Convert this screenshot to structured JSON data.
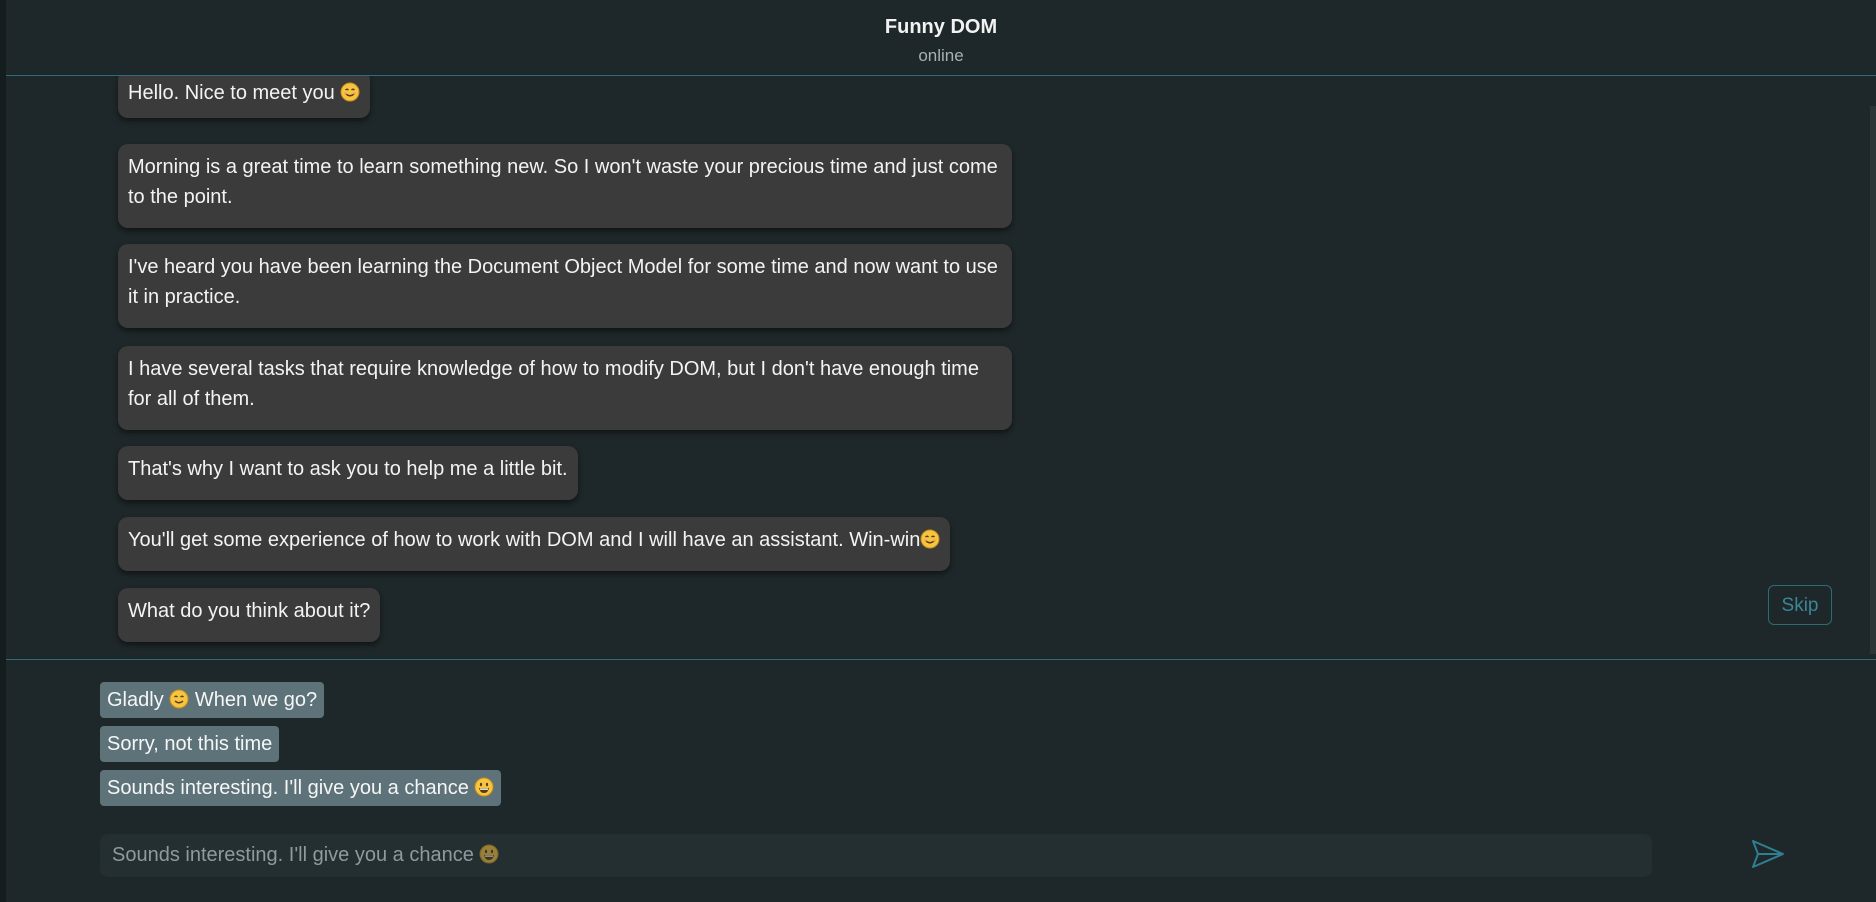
{
  "header": {
    "title": "Funny DOM",
    "status": "online"
  },
  "messages": [
    {
      "text": "Hello. Nice to meet you",
      "emoji": "smiling-face"
    },
    {
      "text": "Morning is a great time to learn something new. So I won't waste your precious time and just come to the point."
    },
    {
      "text": "I've heard you have been learning the Document Object Model for some time and now want to use it in practice."
    },
    {
      "text": "I have several tasks that require knowledge of how to modify DOM, but I don't have enough time for all of them."
    },
    {
      "text": "That's why I want to ask you to help me a little bit."
    },
    {
      "text": "You'll get some experience of how to work with DOM and I will have an assistant. Win-win",
      "emoji": "smiling-face"
    },
    {
      "text": "What do you think about it?"
    }
  ],
  "skip_label": "Skip",
  "replies": [
    {
      "before": "Gladly",
      "emoji": "smiling-face",
      "after": "When we go?"
    },
    {
      "before": "Sorry, not this time"
    },
    {
      "before": "Sounds interesting. I'll give you a chance",
      "emoji": "grinning-face"
    }
  ],
  "input": {
    "value": "Sounds interesting. I'll give you a chance",
    "emoji": "grinning-face"
  },
  "colors": {
    "background": "#1e2729",
    "accent": "#2f6a78",
    "bubble": "#3b3b3b",
    "reply": "#5d7379"
  },
  "icons": {
    "send": "send-arrow-icon"
  }
}
